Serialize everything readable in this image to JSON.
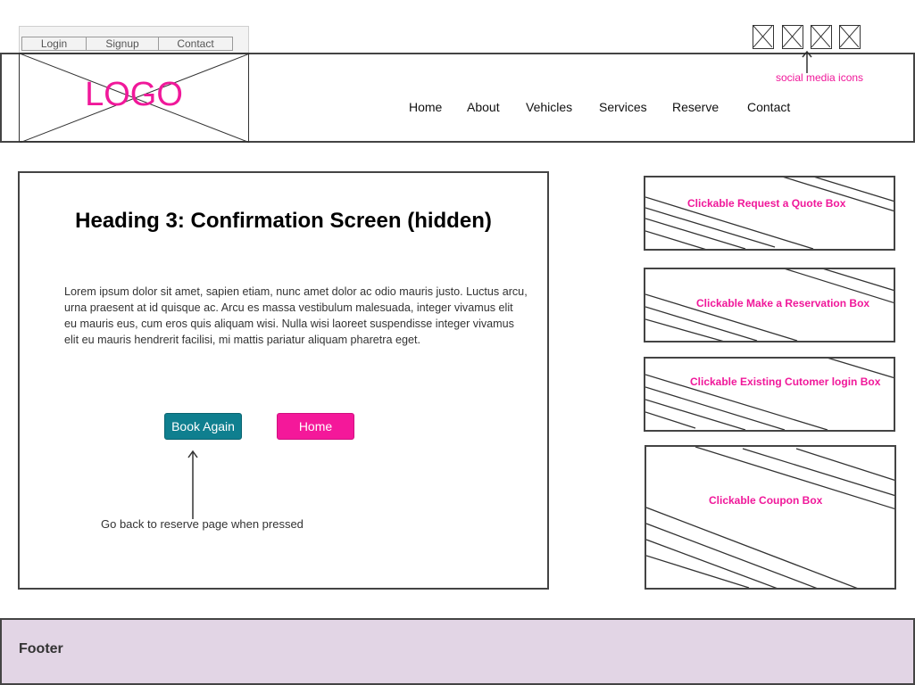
{
  "utility_nav": {
    "login": "Login",
    "signup": "Signup",
    "contact": "Contact"
  },
  "logo": {
    "text": "LOGO"
  },
  "nav": {
    "items": [
      {
        "label": "Home"
      },
      {
        "label": "About"
      },
      {
        "label": "Vehicles"
      },
      {
        "label": "Services"
      },
      {
        "label": "Reserve"
      },
      {
        "label": "Contact"
      }
    ]
  },
  "social": {
    "note": "social media icons"
  },
  "main": {
    "heading": "Heading 3: Confirmation Screen (hidden)",
    "body": "Lorem ipsum dolor sit amet, sapien etiam, nunc amet dolor ac odio mauris justo. Luctus arcu, urna praesent at id quisque ac. Arcu es massa vestibulum malesuada, integer vivamus elit eu mauris eus, cum eros quis aliquam wisi. Nulla wisi laoreet suspendisse integer vivamus elit eu mauris hendrerit facilisi, mi mattis pariatur aliquam pharetra eget.",
    "book_again_label": "Book Again",
    "home_label": "Home",
    "arrow_note": "Go back to reserve page when pressed"
  },
  "sidebar": {
    "quote": "Clickable Request a Quote Box",
    "reservation": "Clickable Make a Reservation Box",
    "login": "Clickable Existing Cutomer login Box",
    "coupon": "Clickable Coupon Box"
  },
  "footer": {
    "label": "Footer"
  },
  "colors": {
    "accent_pink": "#f0189a",
    "accent_teal": "#0f7f8f",
    "footer_bg": "#e2d5e5"
  }
}
